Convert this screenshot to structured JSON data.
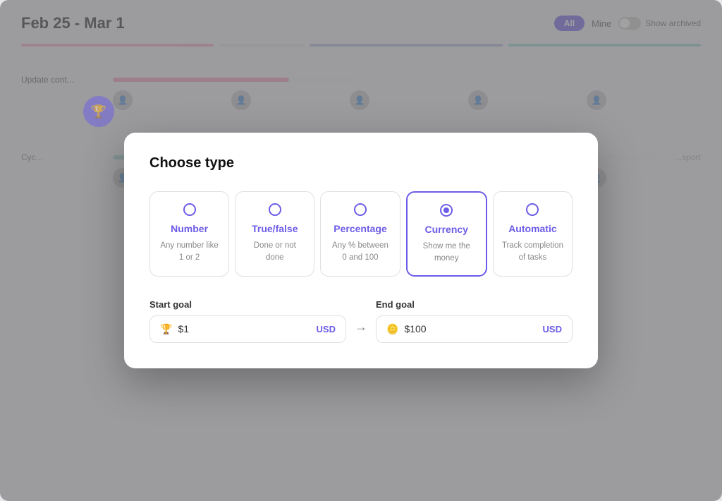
{
  "app": {
    "date_range": "Feb 25 - Mar 1",
    "filter_all": "All",
    "filter_mine": "Mine",
    "show_archived": "Show archived",
    "trophy_icon": "🏆",
    "arrow_icon": "→"
  },
  "modal": {
    "title": "Choose type",
    "types": [
      {
        "id": "number",
        "name": "Number",
        "desc": "Any number like 1 or 2",
        "selected": false
      },
      {
        "id": "true_false",
        "name": "True/false",
        "desc": "Done or not done",
        "selected": false
      },
      {
        "id": "percentage",
        "name": "Percentage",
        "desc": "Any % between 0 and 100",
        "selected": false
      },
      {
        "id": "currency",
        "name": "Currency",
        "desc": "Show me the money",
        "selected": true
      },
      {
        "id": "automatic",
        "name": "Automatic",
        "desc": "Track completion of tasks",
        "selected": false
      }
    ],
    "start_goal": {
      "label": "Start goal",
      "value": "$1",
      "currency": "USD"
    },
    "end_goal": {
      "label": "End goal",
      "value": "$100",
      "currency": "USD"
    }
  },
  "colors": {
    "accent": "#6c5ce7",
    "accent_light": "#e8e4ff"
  }
}
